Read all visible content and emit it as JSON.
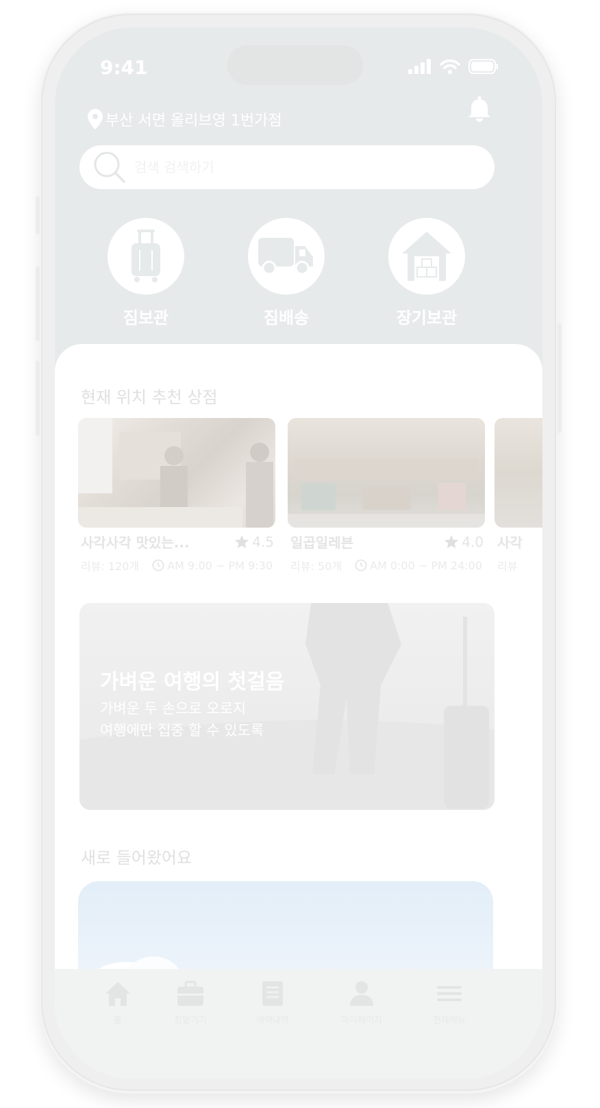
{
  "status_bar": {
    "time": "9:41"
  },
  "header": {
    "location": "부산 서면 올리브영 1번가점",
    "icons": [
      "map-pin-icon",
      "bell-icon"
    ]
  },
  "search": {
    "placeholder": "검색 검색하기"
  },
  "services": [
    {
      "label": "짐보관",
      "icon": "suitcase-icon"
    },
    {
      "label": "짐배송",
      "icon": "truck-icon"
    },
    {
      "label": "장기보관",
      "icon": "warehouse-icon"
    }
  ],
  "recommend": {
    "title": "현재 위치 추천 상점",
    "stores": [
      {
        "name": "사각사각 맛있는...",
        "rating": "4.5",
        "reviews": "리뷰: 120개",
        "hours": "AM 9:00 ~ PM 9:30"
      },
      {
        "name": "일곱일레븐",
        "rating": "4.0",
        "reviews": "리뷰: 50개",
        "hours": "AM 0:00 ~ PM 24:00"
      },
      {
        "name": "사각",
        "rating": "",
        "reviews": "리뷰",
        "hours": ""
      }
    ]
  },
  "banner": {
    "title": "가벼운 여행의 첫걸음",
    "line1": "가벼운 두 손으로 오로지",
    "line2": "여행에만 집중 할 수 있도록"
  },
  "new_arrivals": {
    "title": "새로 들어왔어요"
  },
  "tabbar": [
    {
      "label": "홈",
      "icon": "home-icon"
    },
    {
      "label": "짐맡기기",
      "icon": "briefcase-icon"
    },
    {
      "label": "예약내역",
      "icon": "document-icon"
    },
    {
      "label": "마이페이지",
      "icon": "user-icon"
    },
    {
      "label": "전체메뉴",
      "icon": "menu-icon"
    }
  ],
  "colors": {
    "top_background": "#e7eaeb",
    "card_background": "#ffffff",
    "star": "#e2dfdf",
    "tabbar_background": "#f1f2f2"
  }
}
